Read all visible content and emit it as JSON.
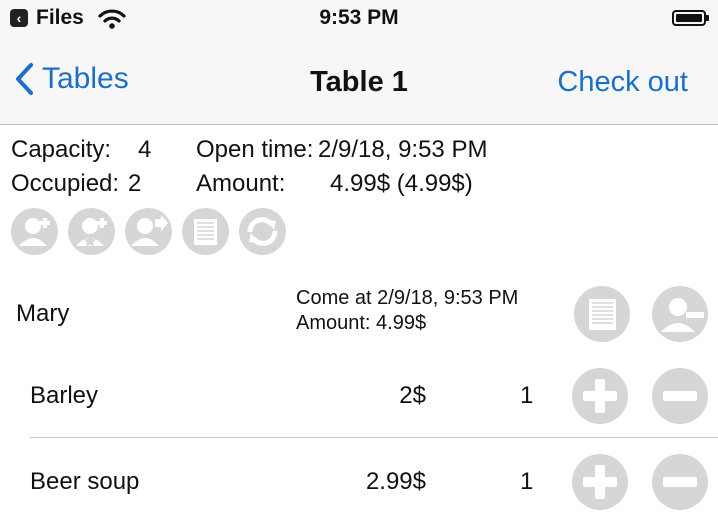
{
  "status_bar": {
    "back_app": "Files",
    "time": "9:53 PM"
  },
  "nav": {
    "back_label": "Tables",
    "title": "Table 1",
    "action_label": "Check out"
  },
  "table_info": {
    "capacity_label": "Capacity:",
    "capacity_value": "4",
    "occupied_label": "Occupied:",
    "occupied_value": "2",
    "open_time_label": "Open time:",
    "open_time_value": "2/9/18, 9:53 PM",
    "amount_label": "Amount:",
    "amount_value": "4.99$ (4.99$)"
  },
  "actions": [
    "add-guest-icon",
    "add-vip-guest-icon",
    "move-guest-icon",
    "receipt-icon",
    "refresh-icon"
  ],
  "customer": {
    "name": "Mary",
    "come_at": "Come at 2/9/18, 9:53 PM",
    "amount": "Amount: 4.99$"
  },
  "items": [
    {
      "name": "Barley",
      "price": "2$",
      "qty": "1"
    },
    {
      "name": "Beer soup",
      "price": "2.99$",
      "qty": "1"
    }
  ],
  "colors": {
    "accent": "#1a70c8",
    "icon_gray": "#d6d6d6"
  }
}
